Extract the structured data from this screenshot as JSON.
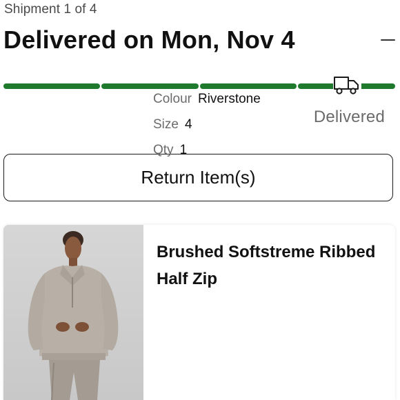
{
  "shipment": {
    "label": "Shipment 1 of 4",
    "status_title": "Delivered on Mon, Nov 4",
    "collapse_icon": "minus-icon"
  },
  "progress": {
    "segments_total": 4,
    "segments_complete": 4,
    "fraction_complete": 1.0,
    "icon": "delivery-truck-icon",
    "status_label": "Delivered",
    "color": "#1f7a2e"
  },
  "actions": {
    "return_label": "Return Item(s)"
  },
  "product": {
    "image_icon": "product-photo",
    "name": "Brushed Softstreme Ribbed Half Zip",
    "details": [
      {
        "label": "Colour",
        "value": "Riverstone"
      },
      {
        "label": "Size",
        "value": "4"
      },
      {
        "label": "Qty",
        "value": "1"
      }
    ]
  }
}
